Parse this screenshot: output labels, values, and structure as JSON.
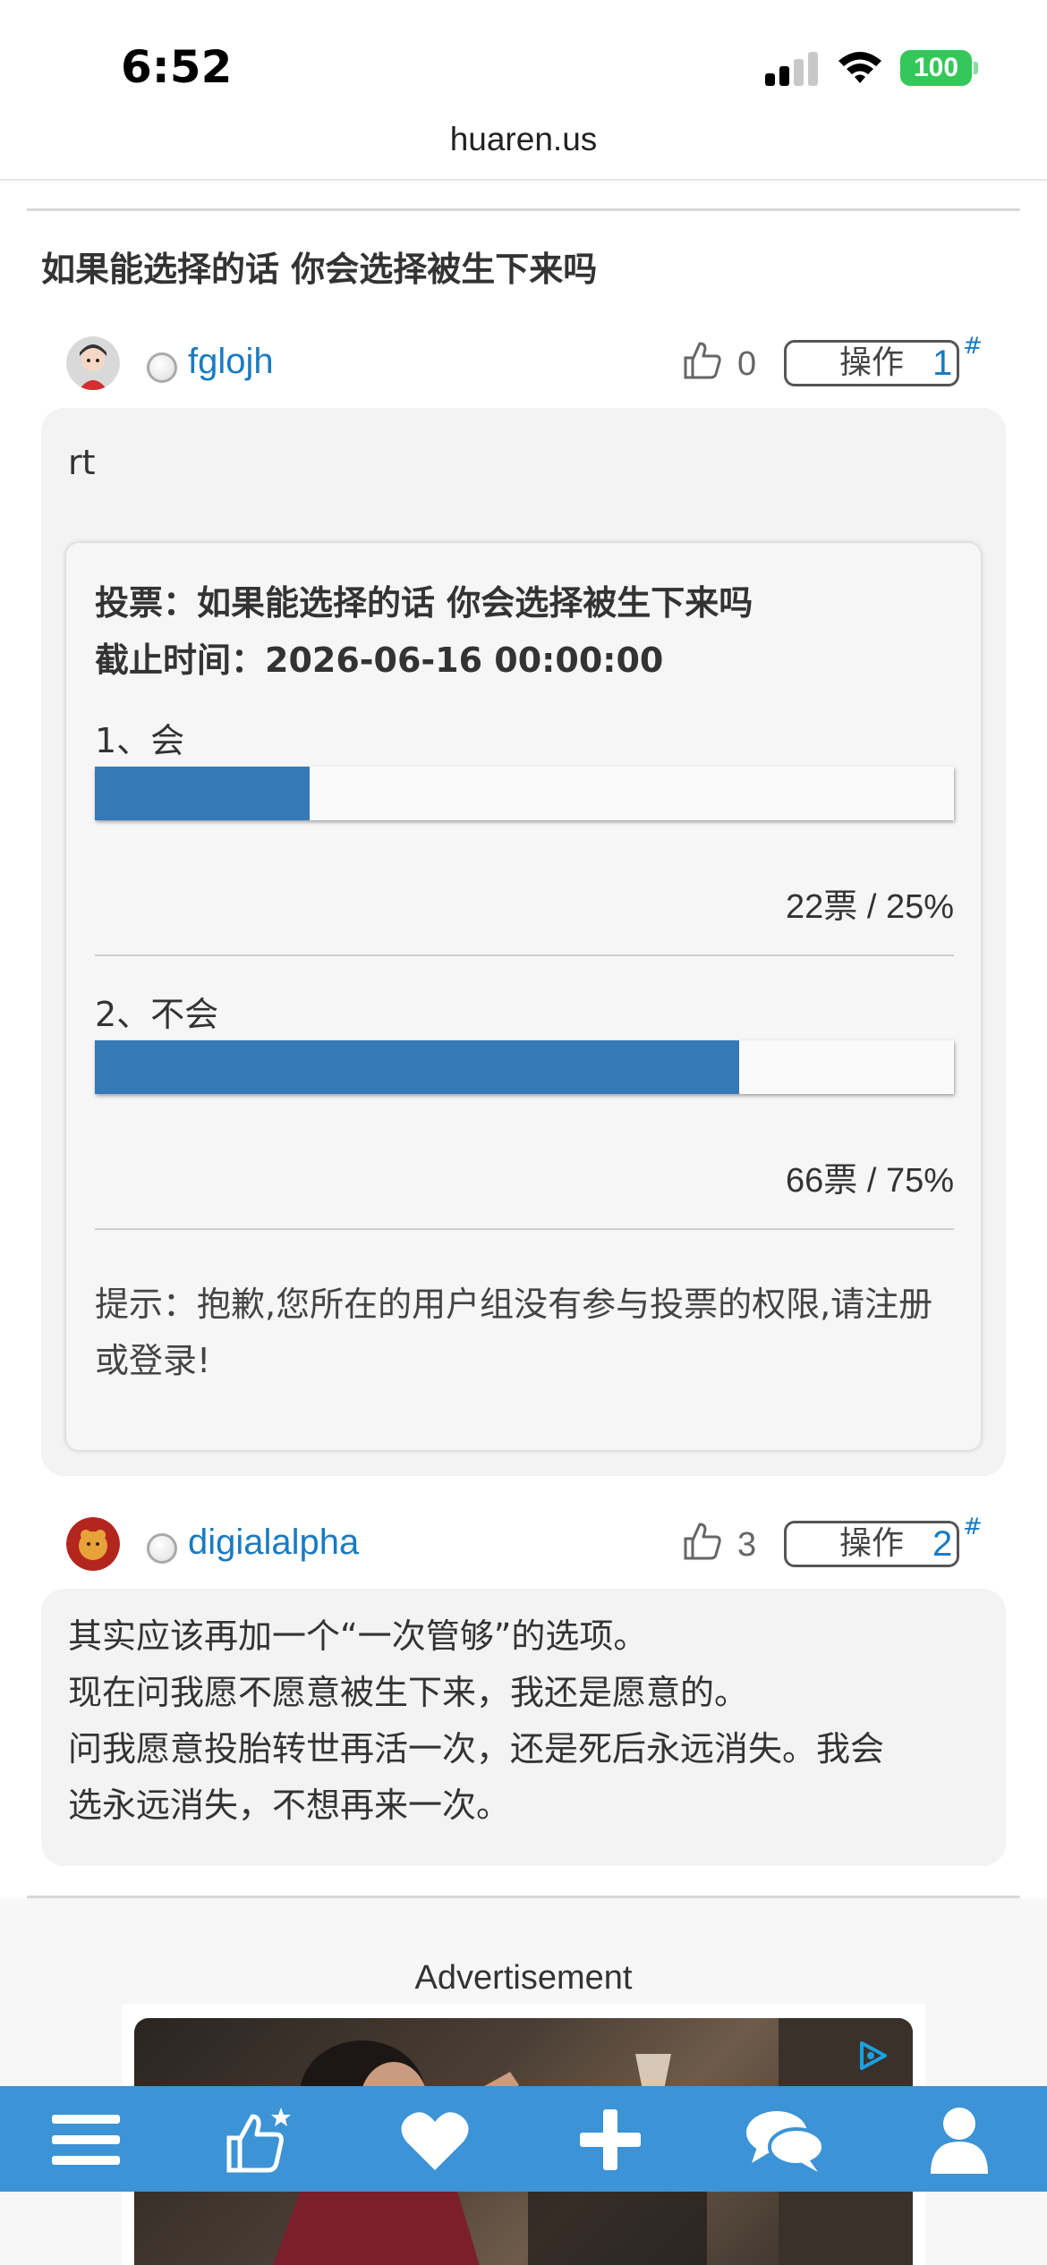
{
  "status_bar": {
    "time": "6:52",
    "battery": "100"
  },
  "browser": {
    "url": "huaren.us"
  },
  "thread": {
    "title": "如果能选择的话 你会选择被生下来吗"
  },
  "posts": [
    {
      "username": "fglojh",
      "likes": "0",
      "op_label": "操作",
      "floor": "1",
      "floor_mark": "#",
      "text": "rt"
    },
    {
      "username": "digialalpha",
      "likes": "3",
      "op_label": "操作",
      "floor": "2",
      "floor_mark": "#",
      "text": "其实应该再加一个“一次管够”的选项。\n现在问我愿不愿意被生下来，我还是愿意的。\n问我愿意投胎转世再活一次，还是死后永远消失。我会\n选永远消失，不想再来一次。"
    }
  ],
  "poll": {
    "title": "投票：如果能选择的话 你会选择被生下来吗",
    "deadline": "截止时间：2026-06-16 00:00:00",
    "options": [
      {
        "label": "1、会",
        "result": "22票 / 25%",
        "fraction": 0.25
      },
      {
        "label": "2、不会",
        "result": "66票 / 75%",
        "fraction": 0.75
      }
    ],
    "tip": "提示：抱歉,您所在的用户组没有参与投票的权限,请注册或登录!",
    "bar_color": "#3579b8"
  },
  "ad": {
    "label": "Advertisement"
  },
  "bottom_nav": {
    "color": "#3c93d6",
    "items": [
      "menu-icon",
      "thumbs-up-star-icon",
      "heart-icon",
      "plus-icon",
      "chat-bubbles-icon",
      "user-icon"
    ]
  },
  "colors": {
    "link": "#1a7bc1",
    "battery": "#34c759"
  }
}
